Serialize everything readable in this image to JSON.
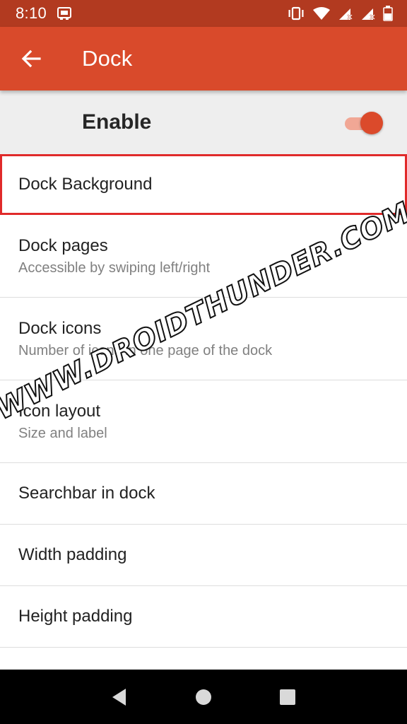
{
  "status_bar": {
    "time": "8:10",
    "icons": [
      "cast-icon",
      "vibrate-icon",
      "wifi-icon",
      "signal-icon",
      "signal-icon-2",
      "battery-icon"
    ]
  },
  "app_bar": {
    "title": "Dock",
    "back_icon": "arrow-left-icon"
  },
  "enable_row": {
    "label": "Enable",
    "toggle_on": true
  },
  "list": {
    "items": [
      {
        "title": "Dock Background",
        "subtitle": ""
      },
      {
        "title": "Dock pages",
        "subtitle": "Accessible by swiping left/right"
      },
      {
        "title": "Dock icons",
        "subtitle": "Number of icons in one page of the dock"
      },
      {
        "title": "Icon layout",
        "subtitle": "Size and label"
      },
      {
        "title": "Searchbar in dock",
        "subtitle": ""
      },
      {
        "title": "Width padding",
        "subtitle": ""
      },
      {
        "title": "Height padding",
        "subtitle": ""
      }
    ]
  },
  "watermark": "WWW.DROIDTHUNDER.COM",
  "colors": {
    "status_bar": "#b23a20",
    "app_bar": "#d94a2b",
    "accent": "#db4a2b",
    "highlight_border": "#e02a2a"
  },
  "nav_bar": {
    "icons": [
      "back-triangle-icon",
      "home-circle-icon",
      "recents-square-icon"
    ]
  }
}
